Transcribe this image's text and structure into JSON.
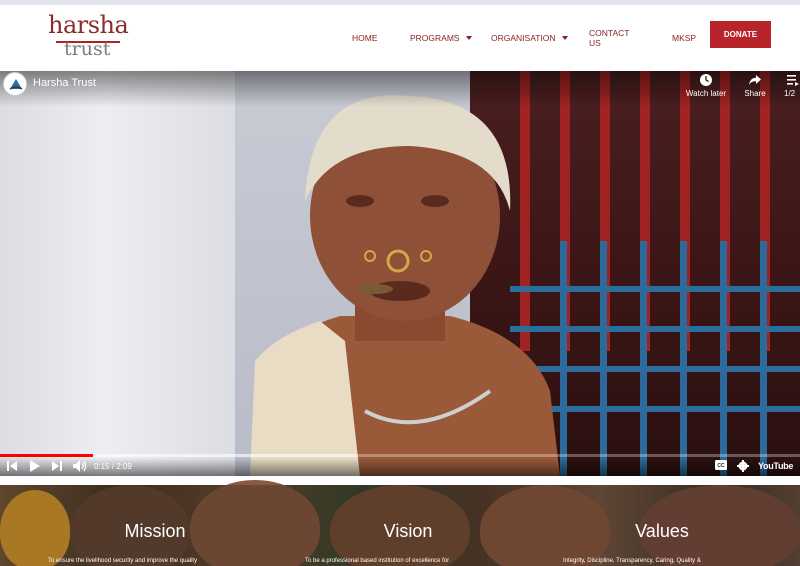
{
  "brand": {
    "logo_line1": "harsha",
    "logo_line2": "trust"
  },
  "nav": {
    "items": [
      {
        "label": "HOME",
        "dropdown": false
      },
      {
        "label": "PROGRAMS",
        "dropdown": true
      },
      {
        "label": "ORGANISATION",
        "dropdown": true
      },
      {
        "label": "CONTACT US",
        "dropdown": false
      },
      {
        "label": "MKSP",
        "dropdown": false
      }
    ],
    "donate_label": "DONATE"
  },
  "video": {
    "title": "Harsha Trust",
    "watch_later_label": "Watch later",
    "share_label": "Share",
    "playlist_label": "1/2",
    "current_time": "0:15",
    "duration": "2:09",
    "timecode": "0:15 / 2:09",
    "progress_fraction": 0.116,
    "buffered_fraction": 0.445,
    "platform_label": "YouTube"
  },
  "pillars": [
    {
      "title": "Mission",
      "text": "To ensure the livelihood security and improve the quality"
    },
    {
      "title": "Vision",
      "text": "To be a professional based institution of excellence for"
    },
    {
      "title": "Values",
      "text": "Integrity, Discipline, Transparency, Caring, Quality &"
    }
  ],
  "colors": {
    "brand_red": "#b8242a",
    "nav_text": "#8b1e1e",
    "progress_red": "#ff0000"
  },
  "icons": [
    "channel-avatar-icon",
    "clock-icon",
    "share-icon",
    "playlist-icon",
    "skip-back-icon",
    "play-icon",
    "skip-next-icon",
    "volume-icon",
    "captions-icon",
    "settings-icon"
  ]
}
